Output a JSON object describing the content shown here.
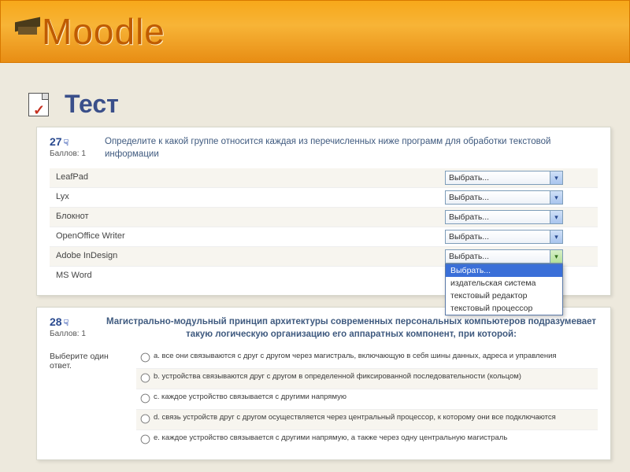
{
  "brand": "Moodle",
  "page_title": "Тест",
  "select_placeholder": "Выбрать...",
  "dropdown_options": [
    "Выбрать...",
    "издательская система",
    "текстовый редактор",
    "текстовый процессор"
  ],
  "q1": {
    "number": "27",
    "score": "Баллов: 1",
    "text": "Определите к какой группе относится каждая из перечисленных ниже программ для обработки текстовой информации",
    "items": [
      "LeafPad",
      "Lyx",
      "Блокнот",
      "OpenOffice Writer",
      "Adobe InDesign",
      "MS Word"
    ]
  },
  "q2": {
    "number": "28",
    "score": "Баллов: 1",
    "text": "Магистрально-модульный принцип архитектуры современных персональных компьютеров подразумевает такую логическую организацию его аппаратных компонент, при которой:",
    "prompt": "Выберите один ответ.",
    "options": [
      "a. все они связываются с друг с другом через магистраль, включающую в себя шины данных, адреса и управления",
      "b. устройства связываются друг с другом в определенной фиксированной последовательности (кольцом)",
      "c. каждое устройство связывается с другими напрямую",
      "d. связь устройств друг с другом осуществляется через центральный процессор, к которому они все подключаются",
      "e. каждое устройство связывается с другими напрямую, а также через одну центральную магистраль"
    ]
  }
}
